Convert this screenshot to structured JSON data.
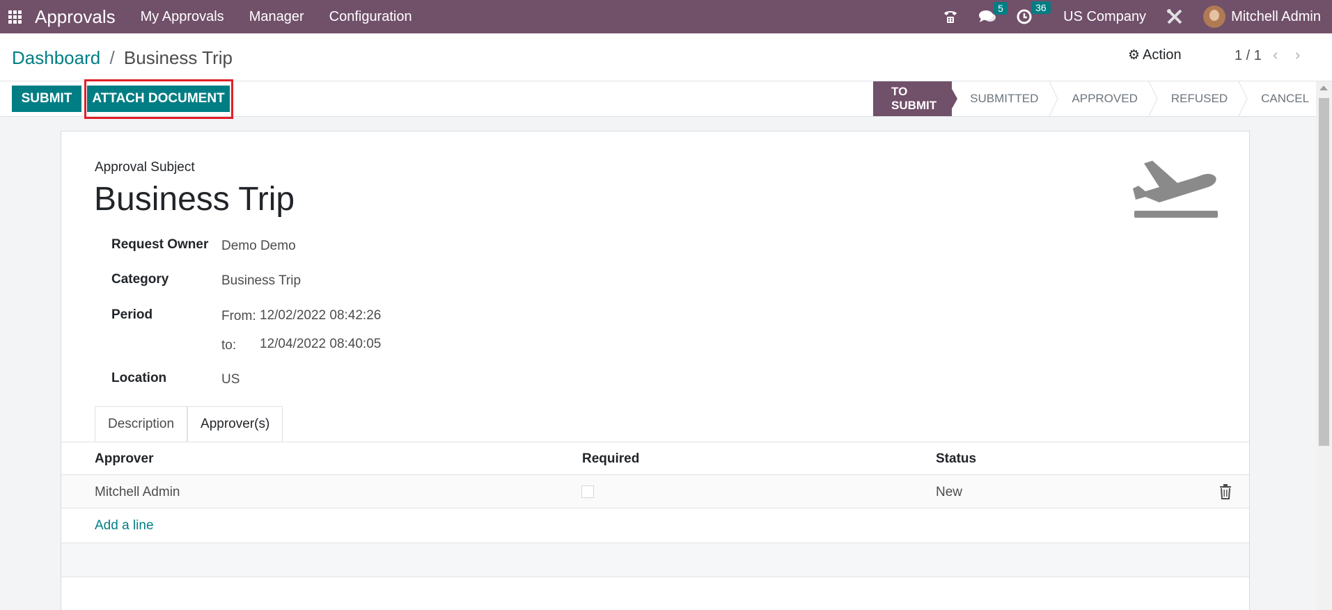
{
  "navbar": {
    "app_title": "Approvals",
    "menu": [
      "My Approvals",
      "Manager",
      "Configuration"
    ],
    "messages_count": "5",
    "activities_count": "36",
    "company": "US Company",
    "user": "Mitchell Admin",
    "accent_color": "#71506a"
  },
  "breadcrumb": {
    "parent": "Dashboard",
    "separator": "/",
    "current": "Business Trip"
  },
  "control": {
    "action_label": "Action",
    "pager": "1 / 1"
  },
  "buttons": {
    "submit": "SUBMIT",
    "attach": "ATTACH DOCUMENT"
  },
  "stages": [
    "TO SUBMIT",
    "SUBMITTED",
    "APPROVED",
    "REFUSED",
    "CANCEL"
  ],
  "form": {
    "subject_label": "Approval Subject",
    "subject": "Business Trip",
    "fields": {
      "owner_label": "Request Owner",
      "owner": "Demo Demo",
      "category_label": "Category",
      "category": "Business Trip",
      "period_label": "Period",
      "from_label": "From:",
      "from": "12/02/2022 08:42:26",
      "to_label": "to:",
      "to": "12/04/2022 08:40:05",
      "location_label": "Location",
      "location": "US"
    }
  },
  "tabs": [
    "Description",
    "Approver(s)"
  ],
  "approvers_table": {
    "headers": [
      "Approver",
      "Required",
      "Status"
    ],
    "rows": [
      {
        "approver": "Mitchell Admin",
        "required": false,
        "status": "New"
      }
    ],
    "add_line": "Add a line"
  }
}
